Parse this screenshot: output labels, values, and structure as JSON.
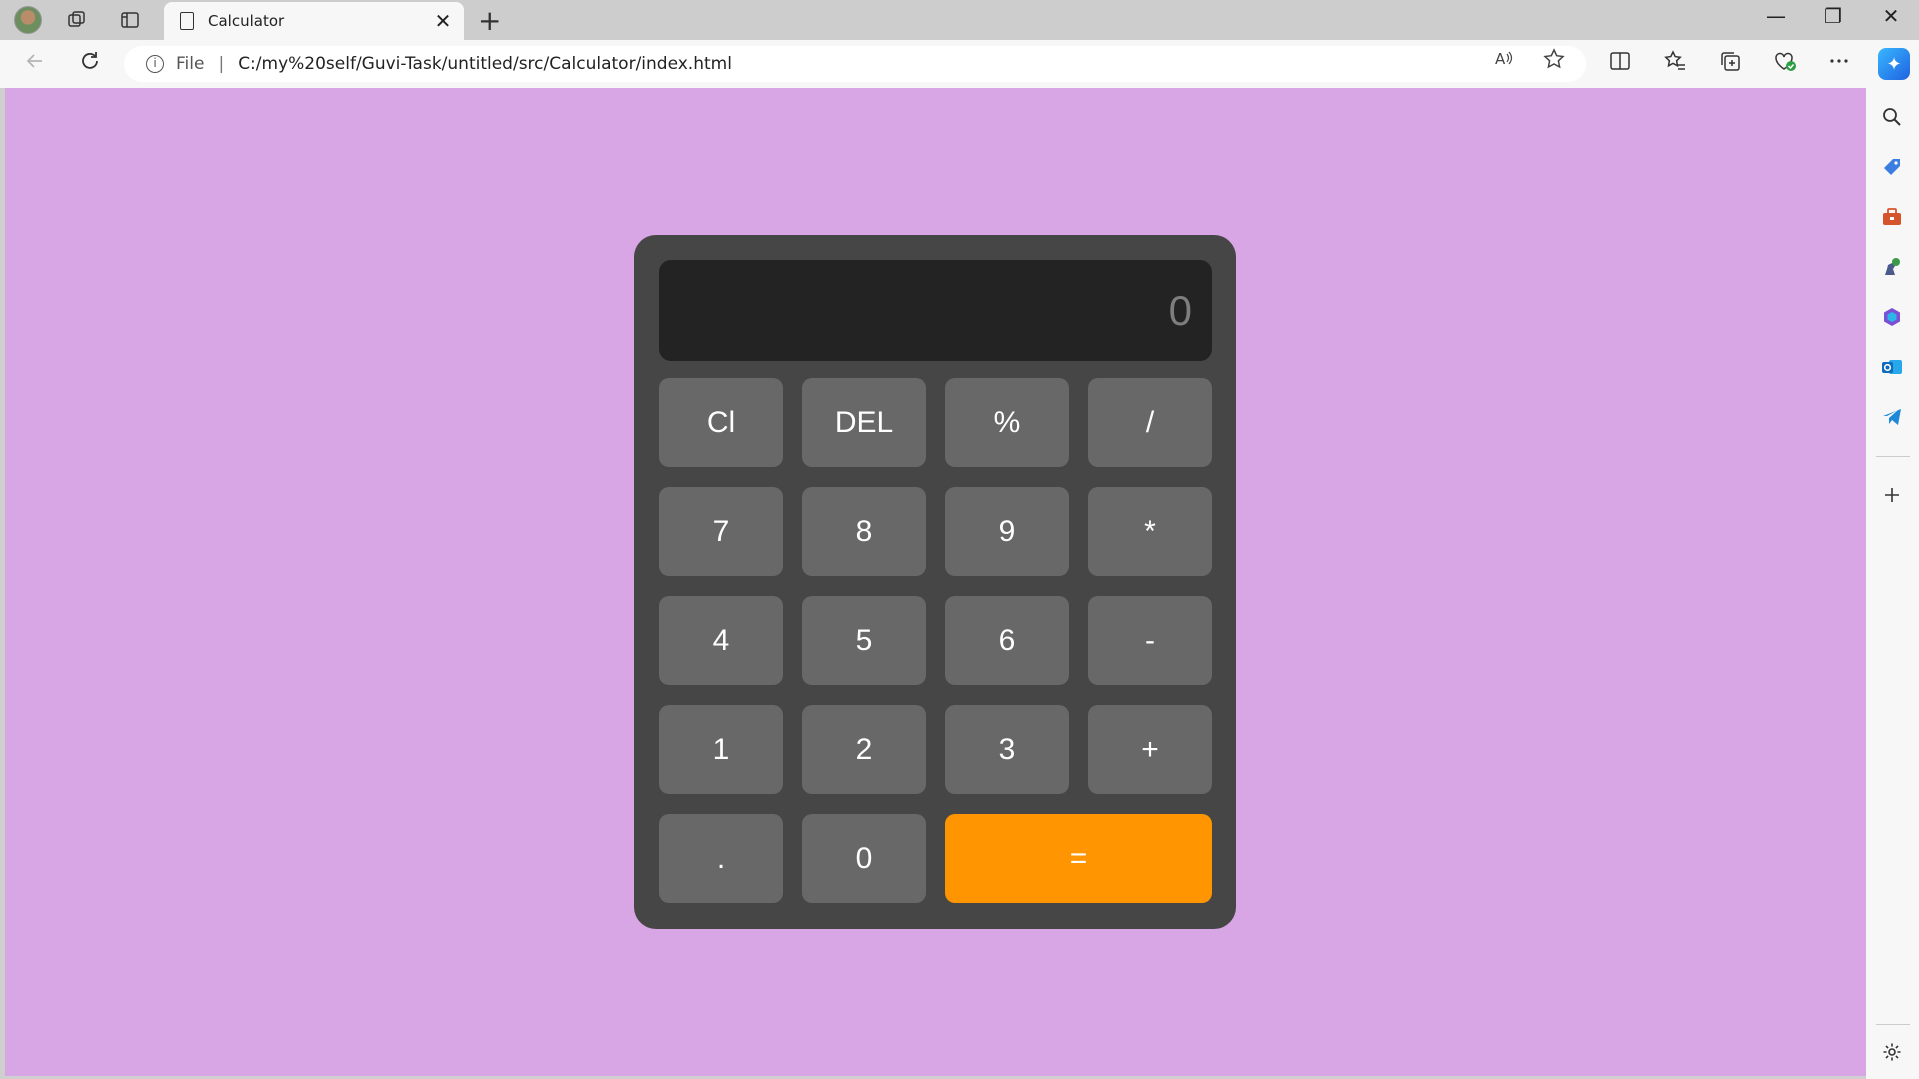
{
  "browser": {
    "tab_title": "Calculator",
    "tab_close": "✕",
    "new_tab": "+",
    "address_scheme": "File",
    "address_separator": "|",
    "address_url": "C:/my%20self/Guvi-Task/untitled/src/Calculator/index.html",
    "window_controls": [
      "—",
      "❐",
      "✕"
    ]
  },
  "calculator": {
    "display_value": "0",
    "keys": {
      "clear": "Cl",
      "delete": "DEL",
      "percent": "%",
      "divide": "/",
      "seven": "7",
      "eight": "8",
      "nine": "9",
      "multiply": "*",
      "four": "4",
      "five": "5",
      "six": "6",
      "subtract": "-",
      "one": "1",
      "two": "2",
      "three": "3",
      "add": "+",
      "decimal": ".",
      "zero": "0",
      "equals": "="
    }
  },
  "colors": {
    "page_background": "#d8a6e4",
    "calculator_body": "#464646",
    "display_background": "#232323",
    "key_background": "#686868",
    "equals_background": "#ff9500"
  },
  "icons": {
    "titlebar": [
      "profile-avatar",
      "workspaces-icon",
      "vertical-tabs-icon"
    ],
    "toolbar": [
      "read-aloud-icon",
      "favorite-star-icon",
      "split-screen-icon",
      "favorites-icon",
      "collections-icon",
      "browser-essentials-icon",
      "more-icon",
      "copilot-icon"
    ],
    "sidebar": [
      "search-icon",
      "shopping-icon",
      "tools-icon",
      "games-icon",
      "microsoft-365-icon",
      "outlook-icon",
      "telegram-icon",
      "add-icon",
      "settings-icon"
    ]
  }
}
